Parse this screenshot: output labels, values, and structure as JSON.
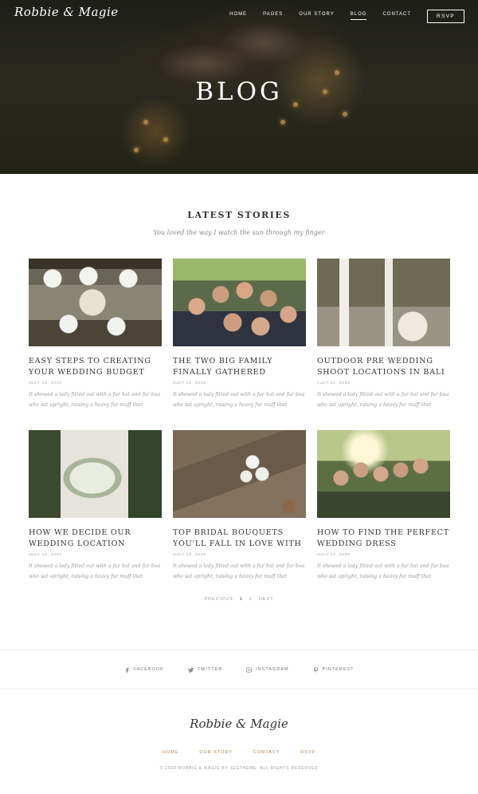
{
  "header": {
    "brand": "Robbie & Magie",
    "nav": [
      "HOME",
      "PAGES",
      "OUR STORY",
      "BLOG",
      "CONTACT"
    ],
    "active_nav": "BLOG",
    "rsvp_label": "RSVP",
    "hero_title": "BLOG"
  },
  "section": {
    "title": "LATEST STORIES",
    "subtitle": "You loved the way I watch the sun through my finger"
  },
  "posts": [
    {
      "title": "EASY STEPS TO CREATING YOUR WEDDING BUDGET",
      "date": "JULY 22, 2020",
      "excerpt": "It showed a lady fitted out with a fur hat and fur boa who sat upright, raising a heavy fur muff that"
    },
    {
      "title": "THE TWO BIG FAMILY FINALLY GATHERED",
      "date": "JULY 22, 2020",
      "excerpt": "It showed a lady fitted out with a fur hat and fur boa who sat upright, raising a heavy fur muff that"
    },
    {
      "title": "OUTDOOR PRE WEDDING SHOOT LOCATIONS IN BALI",
      "date": "JULY 22, 2020",
      "excerpt": "It showed a lady fitted out with a fur hat and fur boa who sat upright, raising a heavy fur muff that"
    },
    {
      "title": "HOW WE DECIDE OUR WEDDING LOCATION",
      "date": "JULY 13, 2020",
      "excerpt": "It showed a lady fitted out with a fur hat and fur boa who sat upright, raising a heavy fur muff that"
    },
    {
      "title": "TOP BRIDAL BOUQUETS YOU'LL FALL IN LOVE WITH",
      "date": "JULY 13, 2020",
      "excerpt": "It showed a lady fitted out with a fur hat and fur boa who sat upright, raising a heavy fur muff that"
    },
    {
      "title": "HOW TO FIND THE PERFECT WEDDING DRESS",
      "date": "JULY 13, 2020",
      "excerpt": "It showed a lady fitted out with a fur hat and fur boa who sat upright, raising a heavy fur muff that"
    }
  ],
  "pagination": {
    "previous": "PREVIOUS",
    "pages": [
      "1",
      "2"
    ],
    "current": "1",
    "next": "NEXT"
  },
  "social": [
    {
      "icon": "facebook-icon",
      "label": "FACEBOOK"
    },
    {
      "icon": "twitter-icon",
      "label": "TWITTER"
    },
    {
      "icon": "instagram-icon",
      "label": "INSTAGRAM"
    },
    {
      "icon": "pinterest-icon",
      "label": "PINTEREST"
    }
  ],
  "footer": {
    "brand": "Robbie & Magie",
    "nav": [
      "HOME",
      "OUR STORY",
      "CONTACT",
      "RSVP"
    ],
    "copyright": "© 2020 ROBBIE & MAGIE BY JEGTHEME. ALL RIGHTS RESERVED"
  },
  "colors": {
    "accent": "#b07e45",
    "text": "#333333",
    "muted": "#999999"
  }
}
